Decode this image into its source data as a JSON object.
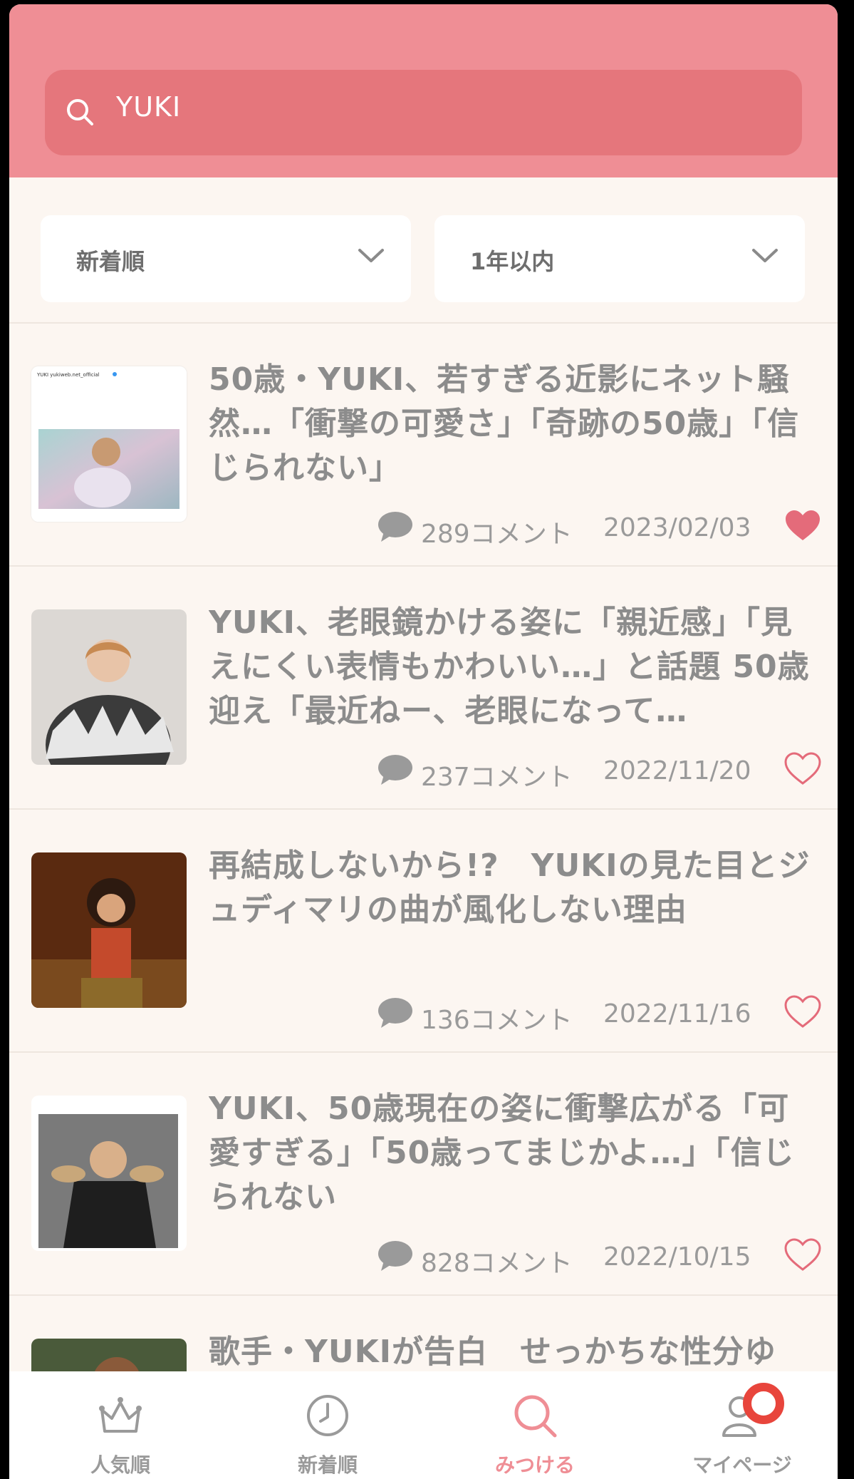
{
  "search": {
    "value": "YUKI"
  },
  "filters": {
    "sort": "新着順",
    "period": "1年以内"
  },
  "articles": [
    {
      "title": "50歳・YUKI、若すぎる近影にネット騒然…「衝撃の可愛さ」「奇跡の50歳」「信じられない」",
      "comments": "289コメント",
      "date": "2023/02/03",
      "liked": true,
      "thumb_text": "YUKI  yukiweb.net_official"
    },
    {
      "title": "YUKI、老眼鏡かける姿に「親近感」「見えにくい表情もかわいい…」と話題 50歳迎え「最近ねー、老眼になって…",
      "comments": "237コメント",
      "date": "2022/11/20",
      "liked": false
    },
    {
      "title": "再結成しないから!?　YUKIの見た目とジュディマリの曲が風化しない理由",
      "comments": "136コメント",
      "date": "2022/11/16",
      "liked": false
    },
    {
      "title": "YUKI、50歳現在の姿に衝撃広がる「可愛すぎる」「50歳ってまじかよ…」「信じられない",
      "comments": "828コメント",
      "date": "2022/10/15",
      "liked": false
    },
    {
      "title": "歌手・YUKIが告白　せっかちな性分ゆ",
      "comments": "",
      "date": "",
      "liked": false
    }
  ],
  "tabs": [
    {
      "label": "人気順",
      "icon": "crown-icon"
    },
    {
      "label": "新着順",
      "icon": "clock-icon"
    },
    {
      "label": "みつける",
      "icon": "search-icon"
    },
    {
      "label": "マイページ",
      "icon": "user-icon"
    }
  ],
  "colors": {
    "header": "#ef8e95",
    "search_bg": "#e5767c",
    "heart": "#e46b7a",
    "badge": "#e8453c"
  }
}
